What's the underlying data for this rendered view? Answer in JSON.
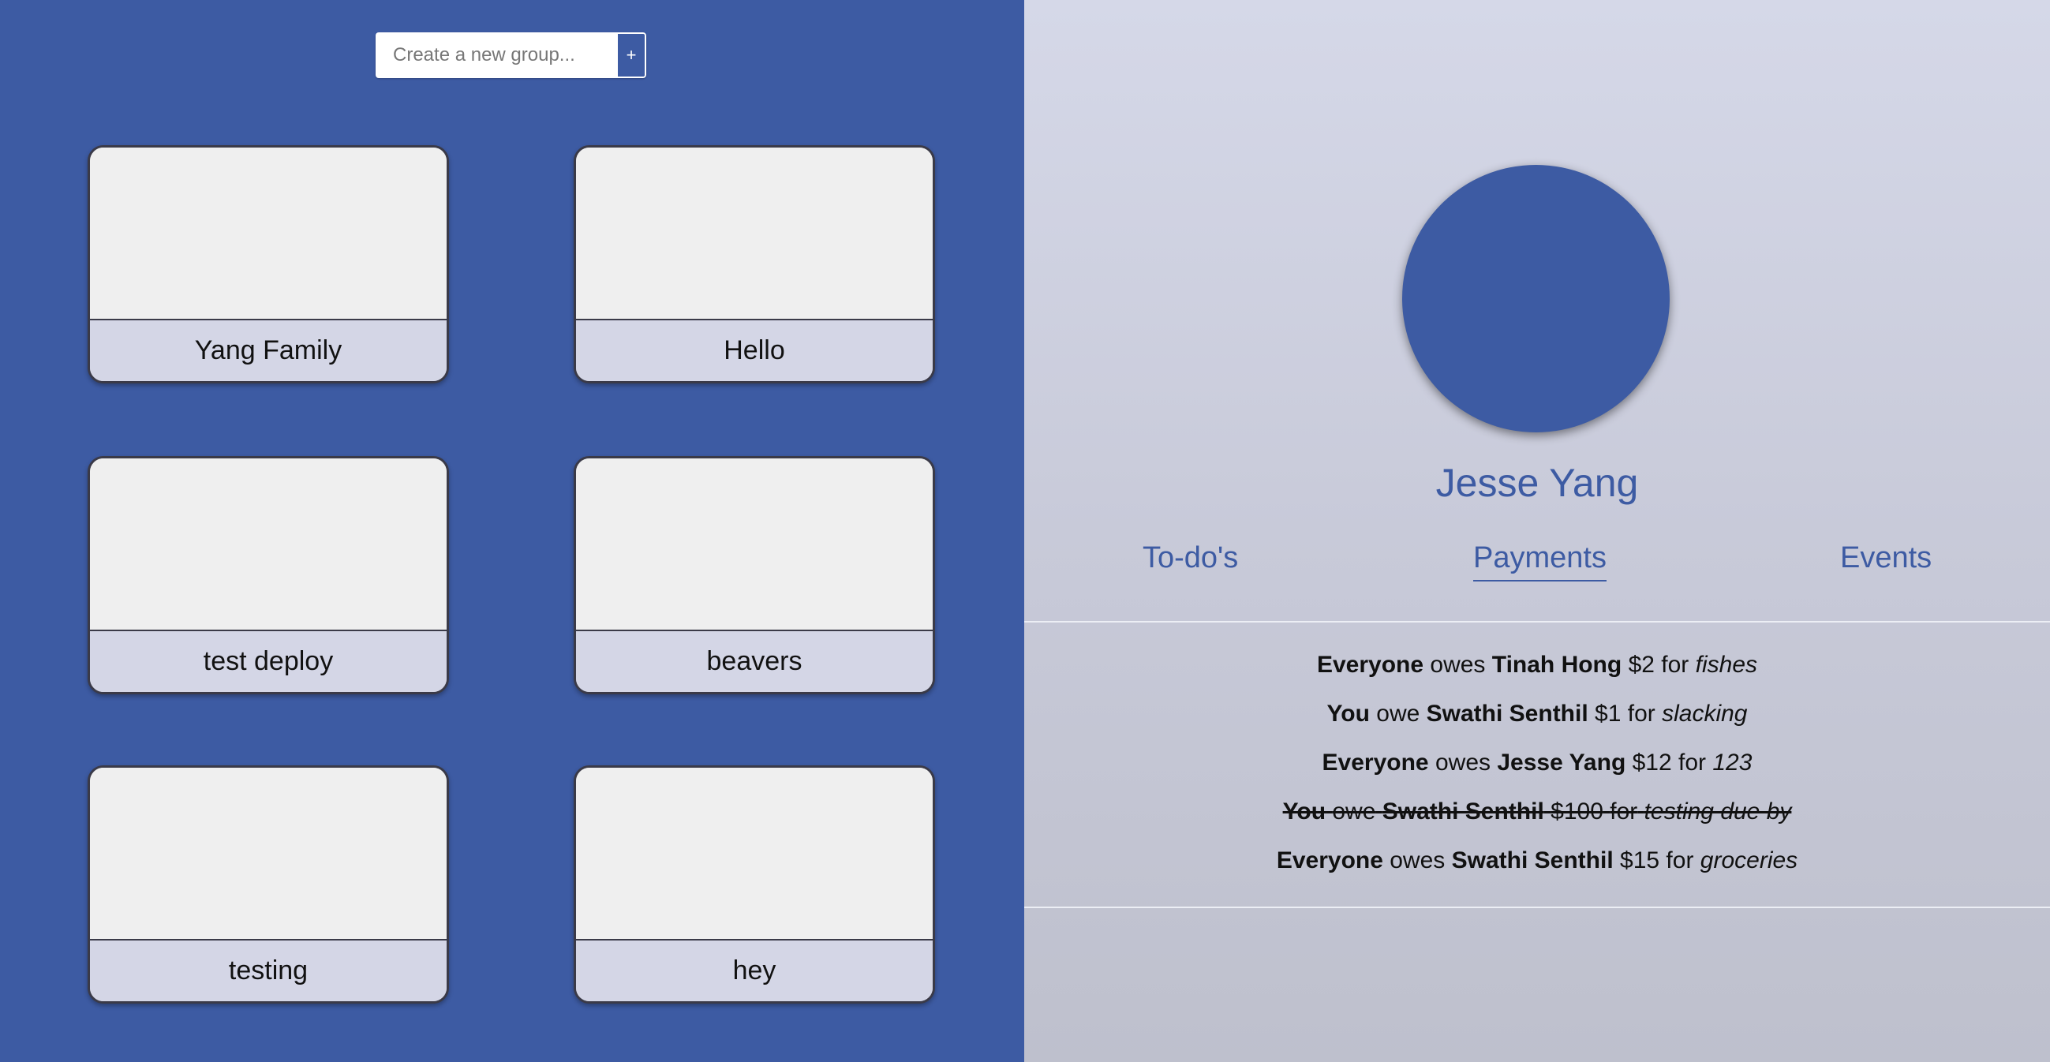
{
  "create_group": {
    "placeholder": "Create a new group...",
    "button_label": "+"
  },
  "groups": [
    {
      "name": "Yang Family"
    },
    {
      "name": "Hello"
    },
    {
      "name": "test deploy"
    },
    {
      "name": "beavers"
    },
    {
      "name": "testing"
    },
    {
      "name": "hey"
    }
  ],
  "profile": {
    "name": "Jesse Yang"
  },
  "tabs": [
    {
      "label": "To-do's",
      "active": false
    },
    {
      "label": "Payments",
      "active": true
    },
    {
      "label": "Events",
      "active": false
    }
  ],
  "payments": [
    {
      "payer": "Everyone",
      "verb": "owes",
      "payee": "Tinah Hong",
      "amount": "$2",
      "for_word": "for",
      "item": "fishes",
      "completed": false
    },
    {
      "payer": "You",
      "verb": "owe",
      "payee": "Swathi Senthil",
      "amount": "$1",
      "for_word": "for",
      "item": "slacking",
      "completed": false
    },
    {
      "payer": "Everyone",
      "verb": "owes",
      "payee": "Jesse Yang",
      "amount": "$12",
      "for_word": "for",
      "item": "123",
      "completed": false
    },
    {
      "payer": "You",
      "verb": "owe",
      "payee": "Swathi Senthil",
      "amount": "$100",
      "for_word": "for",
      "item": "testing due by",
      "completed": true
    },
    {
      "payer": "Everyone",
      "verb": "owes",
      "payee": "Swathi Senthil",
      "amount": "$15",
      "for_word": "for",
      "item": "groceries",
      "completed": false
    }
  ],
  "colors": {
    "primary": "#3d5ba3",
    "card_label_bg": "#d4d6e6",
    "card_bg": "#efefef"
  }
}
